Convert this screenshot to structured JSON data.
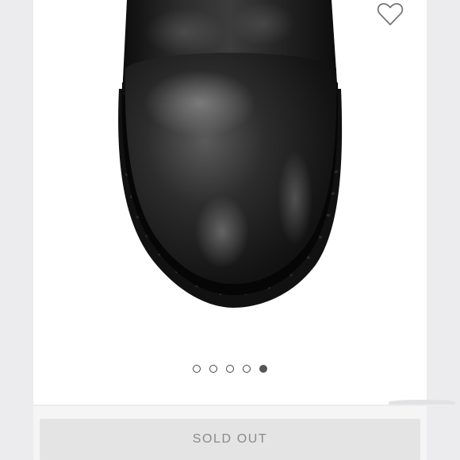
{
  "product": {
    "image": {
      "icon": "black-leather-boot-toe-photo"
    },
    "favorite": {
      "icon": "heart-outline-icon"
    }
  },
  "carousel": {
    "total": 5,
    "active_index": 4
  },
  "actions": {
    "primary_label": "SOLD OUT"
  },
  "colors": {
    "background": "#ececee",
    "card": "#ffffff",
    "button_bg": "#e4e4e4",
    "button_text": "#8a8a8a",
    "dot_active": "#555555"
  }
}
